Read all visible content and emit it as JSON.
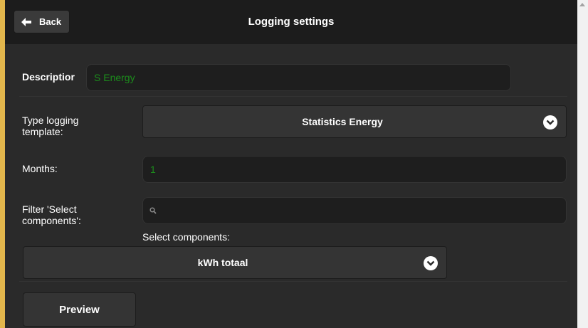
{
  "header": {
    "back_label": "Back",
    "title": "Logging settings"
  },
  "form": {
    "description": {
      "label": "Descriptior",
      "value": "S Energy"
    },
    "template": {
      "label_line1": "Type logging",
      "label_line2": "template:",
      "selected": "Statistics Energy"
    },
    "months": {
      "label": "Months:",
      "value": "1"
    },
    "filter": {
      "label_line1": "Filter 'Select",
      "label_line2": "components':",
      "value": ""
    },
    "components": {
      "label": "Select components:",
      "selected": "kWh totaal"
    },
    "preview_label": "Preview"
  },
  "colors": {
    "accent": "#e2b64c",
    "input_text": "#1c8c1c",
    "header_bg": "#1c1c1c",
    "body_bg": "#2a2a2a"
  },
  "icons": [
    "arrow-left-icon",
    "chevron-down-icon",
    "search-icon",
    "scroll-up-arrow-icon"
  ]
}
